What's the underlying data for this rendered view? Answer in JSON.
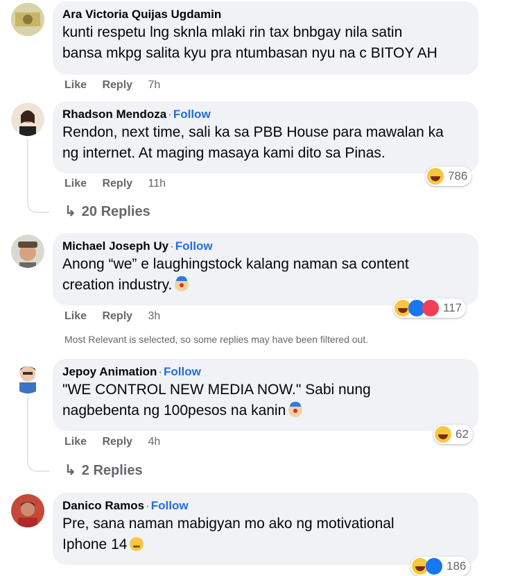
{
  "comments": [
    {
      "author": "Ara Victoria Quijas Ugdamin",
      "follow": "",
      "lines": [
        "kunti respetu lng sknla mlaki rin tax bnbgay nila satin",
        "bansa mkpg salita kyu pra ntumbasan nyu na c BITOY AH"
      ],
      "like": "Like",
      "reply": "Reply",
      "time": "7h"
    },
    {
      "author": "Rhadson Mendoza",
      "follow": "Follow",
      "lines": [
        "Rendon, next time, sali ka sa PBB House para mawalan ka",
        "ng internet. At maging masaya kami dito sa Pinas."
      ],
      "like": "Like",
      "reply": "Reply",
      "time": "11h",
      "reactions": "786",
      "replies": "20 Replies"
    },
    {
      "author": "Michael Joseph Uy",
      "follow": "Follow",
      "lines": [
        "Anong “we” e laughingstock kalang naman sa content",
        "creation industry."
      ],
      "like": "Like",
      "reply": "Reply",
      "time": "3h",
      "reactions": "117",
      "notice": "Most Relevant is selected, so some replies may have been filtered out."
    },
    {
      "author": "Jepoy Animation",
      "follow": "Follow",
      "lines": [
        "\"WE CONTROL NEW MEDIA NOW.\" Sabi nung",
        "nagbebenta ng 100pesos na kanin"
      ],
      "like": "Like",
      "reply": "Reply",
      "time": "4h",
      "reactions": "62",
      "replies": "2 Replies"
    },
    {
      "author": "Danico Ramos",
      "follow": "Follow",
      "lines": [
        "Pre, sana naman mabigyan mo ako ng motivational",
        "Iphone 14"
      ],
      "reactions": "186"
    }
  ],
  "separator": "·"
}
